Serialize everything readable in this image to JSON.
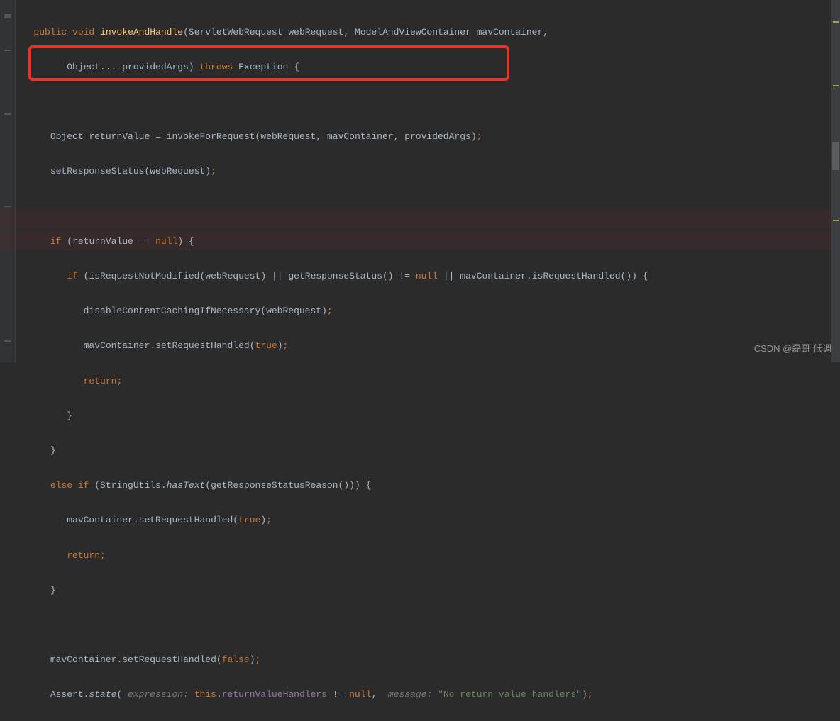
{
  "code": {
    "l1": {
      "kw_public": "public",
      "kw_void": "void",
      "method": "invokeAndHandle",
      "p1_type": "ServletWebRequest",
      "p1_name": "webRequest",
      "p2_type": "ModelAndViewContainer",
      "p2_name": "mavContainer",
      "comma": ","
    },
    "l2": {
      "p3_type": "Object",
      "dots": "...",
      "p3_name": "providedArgs",
      "throws": "throws",
      "exc": "Exception",
      "brace": "{"
    },
    "l4": {
      "type": "Object",
      "var": "returnValue",
      "eq": "=",
      "call": "invokeForRequest",
      "a1": "webRequest",
      "a2": "mavContainer",
      "a3": "providedArgs",
      "semi": ";"
    },
    "l5": {
      "call": "setResponseStatus",
      "a1": "webRequest",
      "semi": ";"
    },
    "l7": {
      "if": "if",
      "var": "returnValue",
      "eq": "==",
      "null": "null",
      "brace": "{"
    },
    "l8": {
      "if": "if",
      "call1": "isRequestNotModified",
      "a1": "webRequest",
      "or": "||",
      "call2": "getResponseStatus",
      "ne": "!=",
      "null": "null",
      "or2": "||",
      "obj": "mavContainer",
      "call3": "isRequestHandled",
      "brace": "{"
    },
    "l9": {
      "call": "disableContentCachingIfNecessary",
      "a1": "webRequest",
      "semi": ";"
    },
    "l10": {
      "obj": "mavContainer",
      "call": "setRequestHandled",
      "true": "true",
      "semi": ";"
    },
    "l11": {
      "ret": "return",
      "semi": ";"
    },
    "l12": {
      "brace": "}"
    },
    "l13": {
      "brace": "}"
    },
    "l14": {
      "else": "else if",
      "cls": "StringUtils",
      "call": "hasText",
      "inner": "getResponseStatusReason",
      "brace": "{"
    },
    "l15": {
      "obj": "mavContainer",
      "call": "setRequestHandled",
      "true": "true",
      "semi": ";"
    },
    "l16": {
      "ret": "return",
      "semi": ";"
    },
    "l17": {
      "brace": "}"
    },
    "l19": {
      "obj": "mavContainer",
      "call": "setRequestHandled",
      "false": "false",
      "semi": ";"
    },
    "l20": {
      "cls": "Assert",
      "call": "state",
      "hint1": "expression:",
      "this": "this",
      "field": "returnValueHandlers",
      "ne": "!=",
      "null": "null",
      "comma": ",",
      "hint2": "message:",
      "str": "\"No return value handlers\"",
      "semi": ";"
    }
  },
  "watermark": "CSDN @磊哥 低调"
}
